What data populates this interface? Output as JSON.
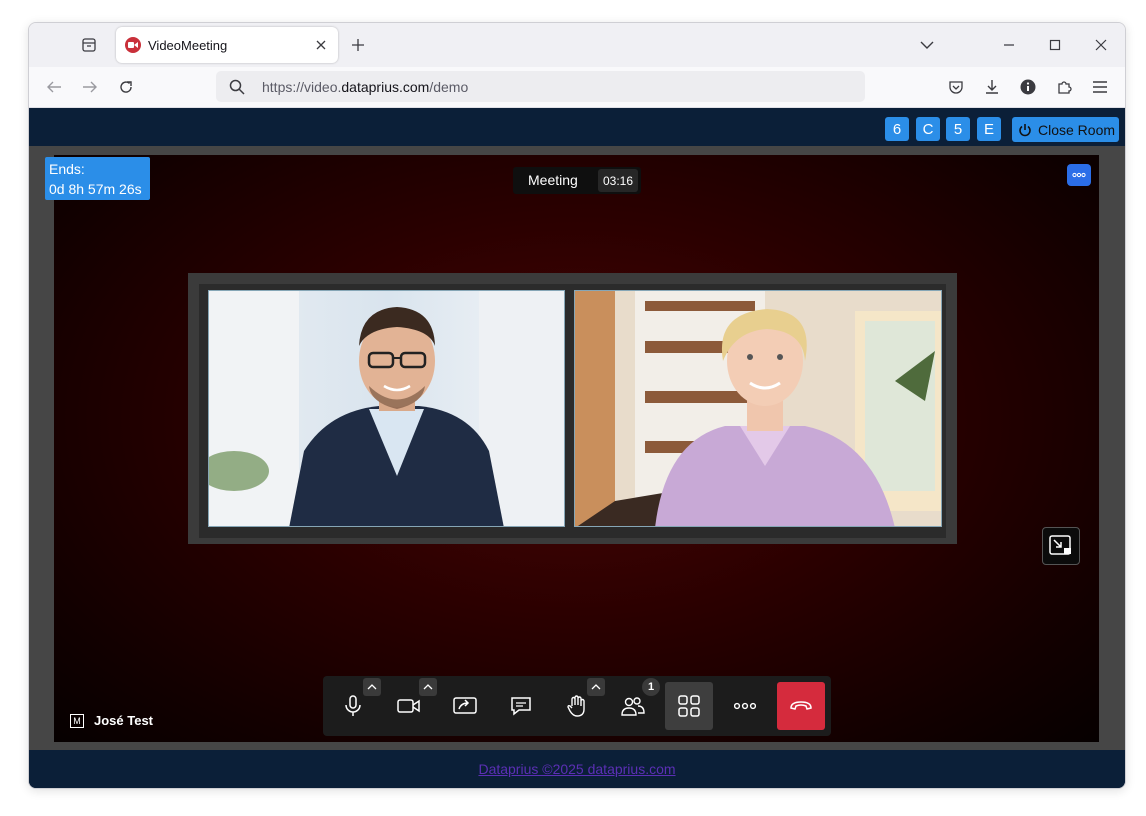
{
  "browser": {
    "tab": {
      "title": "VideoMeeting"
    },
    "url": {
      "prefix": "https://video.",
      "domain": "dataprius.com",
      "path": "/demo"
    }
  },
  "room": {
    "codes": [
      "6",
      "C",
      "5",
      "E"
    ],
    "close_label": "Close Room",
    "ends_label": "Ends:",
    "ends_value": "0d 8h 57m 26s",
    "name": "Meeting",
    "elapsed": "03:16"
  },
  "participant": {
    "badge": "M",
    "name": "José Test"
  },
  "controls": {
    "participants_count": "1"
  },
  "footer": {
    "link_text": "Dataprius ©2025 dataprius.com"
  },
  "colors": {
    "accent": "#2b8ee8",
    "hangup": "#d52b3d",
    "page_bg": "#0b1f38"
  }
}
